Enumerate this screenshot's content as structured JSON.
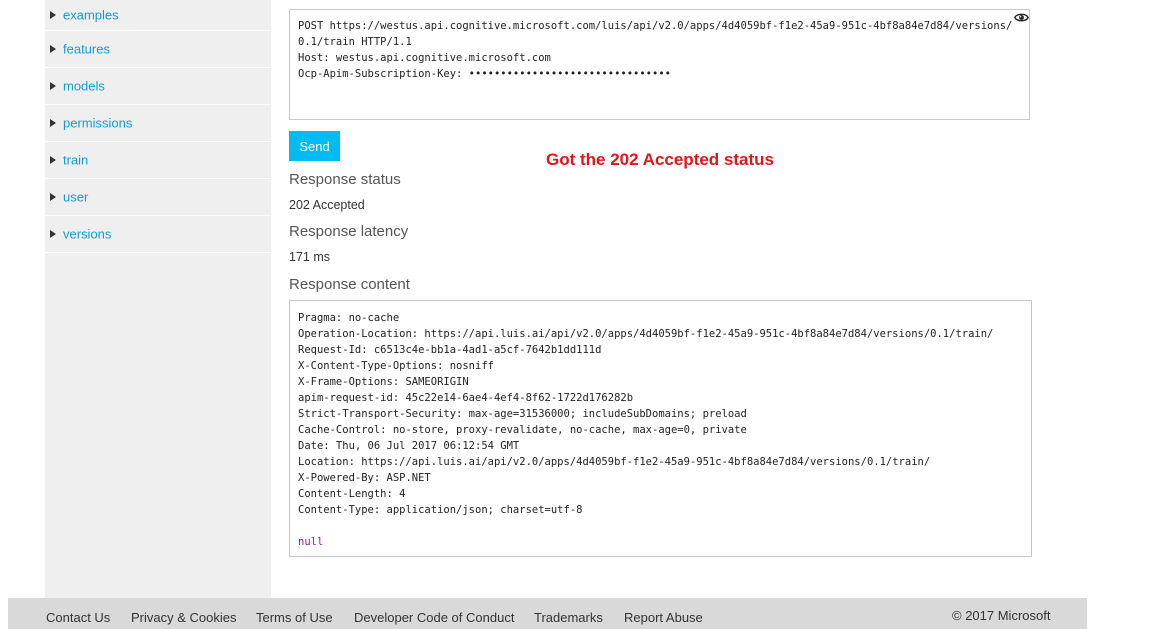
{
  "sidebar": {
    "items": [
      {
        "label": "examples"
      },
      {
        "label": "features"
      },
      {
        "label": "models"
      },
      {
        "label": "permissions"
      },
      {
        "label": "train"
      },
      {
        "label": "user"
      },
      {
        "label": "versions"
      }
    ]
  },
  "request": {
    "text": "POST https://westus.api.cognitive.microsoft.com/luis/api/v2.0/apps/4d4059bf-f1e2-45a9-951c-4bf8a84e7d84/versions/0.1/train HTTP/1.1\nHost: westus.api.cognitive.microsoft.com\nOcp-Apim-Subscription-Key: ••••••••••••••••••••••••••••••••"
  },
  "send_label": "Send",
  "annotation": "Got the 202 Accepted status",
  "response": {
    "status_heading": "Response status",
    "status_value": "202 Accepted",
    "latency_heading": "Response latency",
    "latency_value": "171 ms",
    "content_heading": "Response content",
    "headers": [
      "Pragma: no-cache",
      "Operation-Location: https://api.luis.ai/api/v2.0/apps/4d4059bf-f1e2-45a9-951c-4bf8a84e7d84/versions/0.1/train/",
      "Request-Id: c6513c4e-bb1a-4ad1-a5cf-7642b1dd111d",
      "X-Content-Type-Options: nosniff",
      "X-Frame-Options: SAMEORIGIN",
      "apim-request-id: 45c22e14-6ae4-4ef4-8f62-1722d176282b",
      "Strict-Transport-Security: max-age=31536000; includeSubDomains; preload",
      "Cache-Control: no-store, proxy-revalidate, no-cache, max-age=0, private",
      "Date: Thu, 06 Jul 2017 06:12:54 GMT",
      "Location: https://api.luis.ai/api/v2.0/apps/4d4059bf-f1e2-45a9-951c-4bf8a84e7d84/versions/0.1/train/",
      "X-Powered-By: ASP.NET",
      "Content-Length: 4",
      "Content-Type: application/json; charset=utf-8"
    ],
    "body": "null"
  },
  "footer": {
    "links": [
      "Contact Us",
      "Privacy & Cookies",
      "Terms of Use",
      "Developer Code of Conduct",
      "Trademarks",
      "Report Abuse"
    ],
    "copyright": "© 2017 Microsoft"
  },
  "colors": {
    "accent": "#00bcf2",
    "link": "#0f9ed8",
    "annotation": "#e0161b",
    "null_literal": "#8a1f8c"
  },
  "icons": {
    "sidebar_expander": "triangle-right-icon",
    "reveal_key": "eye-icon"
  }
}
